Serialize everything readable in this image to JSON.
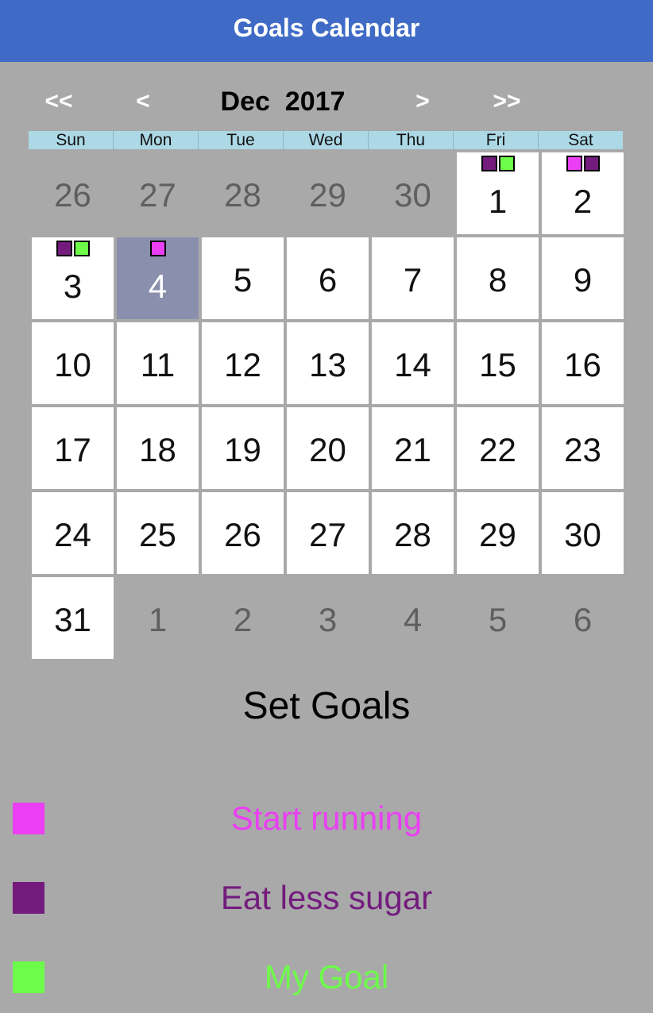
{
  "header": {
    "title": "Goals Calendar"
  },
  "calendar_nav": {
    "prev_year": "<<",
    "prev_month": "<",
    "month_year": "Dec  2017",
    "next_month": ">",
    "next_year": ">>"
  },
  "weekdays": [
    "Sun",
    "Mon",
    "Tue",
    "Wed",
    "Thu",
    "Fri",
    "Sat"
  ],
  "goal_colors": {
    "start_running": "#ea3ff2",
    "eat_less_sugar": "#731c7d",
    "my_goal": "#6dfc4a"
  },
  "days": [
    {
      "day": "26",
      "in_month": false,
      "selected": false,
      "markers": []
    },
    {
      "day": "27",
      "in_month": false,
      "selected": false,
      "markers": []
    },
    {
      "day": "28",
      "in_month": false,
      "selected": false,
      "markers": []
    },
    {
      "day": "29",
      "in_month": false,
      "selected": false,
      "markers": []
    },
    {
      "day": "30",
      "in_month": false,
      "selected": false,
      "markers": []
    },
    {
      "day": "1",
      "in_month": true,
      "selected": false,
      "markers": [
        "eat_less_sugar",
        "my_goal"
      ]
    },
    {
      "day": "2",
      "in_month": true,
      "selected": false,
      "markers": [
        "start_running",
        "eat_less_sugar"
      ]
    },
    {
      "day": "3",
      "in_month": true,
      "selected": false,
      "markers": [
        "eat_less_sugar",
        "my_goal"
      ]
    },
    {
      "day": "4",
      "in_month": true,
      "selected": true,
      "markers": [
        "start_running"
      ]
    },
    {
      "day": "5",
      "in_month": true,
      "selected": false,
      "markers": []
    },
    {
      "day": "6",
      "in_month": true,
      "selected": false,
      "markers": []
    },
    {
      "day": "7",
      "in_month": true,
      "selected": false,
      "markers": []
    },
    {
      "day": "8",
      "in_month": true,
      "selected": false,
      "markers": []
    },
    {
      "day": "9",
      "in_month": true,
      "selected": false,
      "markers": []
    },
    {
      "day": "10",
      "in_month": true,
      "selected": false,
      "markers": []
    },
    {
      "day": "11",
      "in_month": true,
      "selected": false,
      "markers": []
    },
    {
      "day": "12",
      "in_month": true,
      "selected": false,
      "markers": []
    },
    {
      "day": "13",
      "in_month": true,
      "selected": false,
      "markers": []
    },
    {
      "day": "14",
      "in_month": true,
      "selected": false,
      "markers": []
    },
    {
      "day": "15",
      "in_month": true,
      "selected": false,
      "markers": []
    },
    {
      "day": "16",
      "in_month": true,
      "selected": false,
      "markers": []
    },
    {
      "day": "17",
      "in_month": true,
      "selected": false,
      "markers": []
    },
    {
      "day": "18",
      "in_month": true,
      "selected": false,
      "markers": []
    },
    {
      "day": "19",
      "in_month": true,
      "selected": false,
      "markers": []
    },
    {
      "day": "20",
      "in_month": true,
      "selected": false,
      "markers": []
    },
    {
      "day": "21",
      "in_month": true,
      "selected": false,
      "markers": []
    },
    {
      "day": "22",
      "in_month": true,
      "selected": false,
      "markers": []
    },
    {
      "day": "23",
      "in_month": true,
      "selected": false,
      "markers": []
    },
    {
      "day": "24",
      "in_month": true,
      "selected": false,
      "markers": []
    },
    {
      "day": "25",
      "in_month": true,
      "selected": false,
      "markers": []
    },
    {
      "day": "26",
      "in_month": true,
      "selected": false,
      "markers": []
    },
    {
      "day": "27",
      "in_month": true,
      "selected": false,
      "markers": []
    },
    {
      "day": "28",
      "in_month": true,
      "selected": false,
      "markers": []
    },
    {
      "day": "29",
      "in_month": true,
      "selected": false,
      "markers": []
    },
    {
      "day": "30",
      "in_month": true,
      "selected": false,
      "markers": []
    },
    {
      "day": "31",
      "in_month": true,
      "selected": false,
      "markers": []
    },
    {
      "day": "1",
      "in_month": false,
      "selected": false,
      "markers": []
    },
    {
      "day": "2",
      "in_month": false,
      "selected": false,
      "markers": []
    },
    {
      "day": "3",
      "in_month": false,
      "selected": false,
      "markers": []
    },
    {
      "day": "4",
      "in_month": false,
      "selected": false,
      "markers": []
    },
    {
      "day": "5",
      "in_month": false,
      "selected": false,
      "markers": []
    },
    {
      "day": "6",
      "in_month": false,
      "selected": false,
      "markers": []
    }
  ],
  "goals_section": {
    "title": "Set Goals",
    "goals": [
      {
        "id": "start_running",
        "label": "Start running"
      },
      {
        "id": "eat_less_sugar",
        "label": "Eat less sugar"
      },
      {
        "id": "my_goal",
        "label": "My Goal"
      }
    ]
  }
}
